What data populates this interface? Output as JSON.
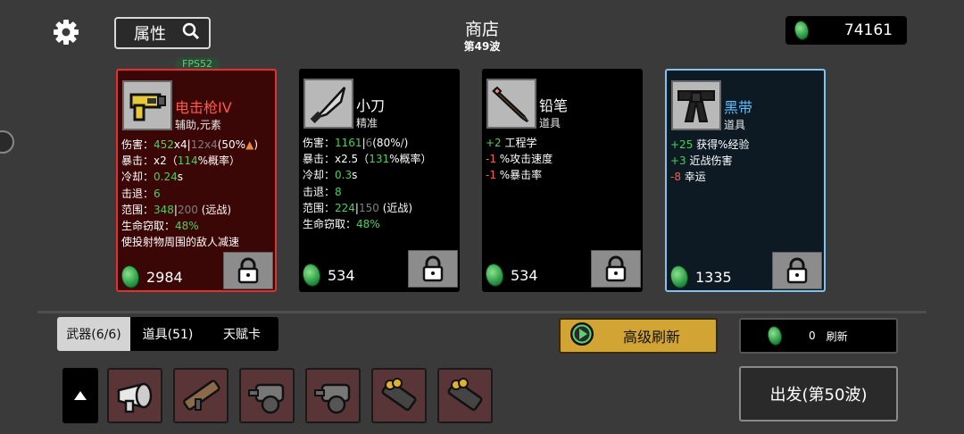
{
  "header": {
    "search_label": "属性",
    "title": "商店",
    "wave": "第49波",
    "money": "74161",
    "fps": "FPS52"
  },
  "cards": [
    {
      "name": "电击枪IV",
      "tag": "辅助,元素",
      "price": "2984",
      "stats": [
        "伤害：452x4|12x4(50%🔥)",
        "暴击：x2（114%概率）",
        "冷却：0.24s",
        "击退：6",
        "范围：348|200 (远战)",
        "生命窃取：48%",
        "使投射物周围的敌人减速"
      ]
    },
    {
      "name": "小刀",
      "tag": "精准",
      "price": "534",
      "stats": [
        "伤害：1161|6(80%🗡)",
        "暴击：x2.5（131%概率）",
        "冷却：0.3s",
        "击退：8",
        "范围：224|150 (近战)",
        "生命窃取：48%"
      ]
    },
    {
      "name": "铅笔",
      "tag": "道具",
      "price": "534",
      "stats": [
        "+2 工程学",
        "-1 %攻击速度",
        "-1 %暴击率"
      ]
    },
    {
      "name": "黑带",
      "tag": "道具",
      "price": "1335",
      "stats": [
        "+25 获得%经验",
        "+3 近战伤害",
        "-8 幸运"
      ]
    }
  ],
  "tabs": [
    "武器(6/6)",
    "道具(51)",
    "天赋卡"
  ],
  "buttons": {
    "advanced_refresh": "高级刷新",
    "refresh_cost": "0",
    "refresh": "刷新",
    "go": "出发(第50波)"
  },
  "inventory": [
    "electric-gun",
    "rocket-launcher",
    "minigun",
    "minigun",
    "grenade-launcher",
    "grenade-launcher"
  ],
  "colors": {
    "background": "#3a3a3a",
    "card_selected_border": "#e03030",
    "card_blue_border": "#7fc3ee",
    "positive": "#49d25a",
    "negative": "#ff5a4a",
    "gold_button": "#d1a434",
    "inventory_slot": "#5a3538"
  }
}
